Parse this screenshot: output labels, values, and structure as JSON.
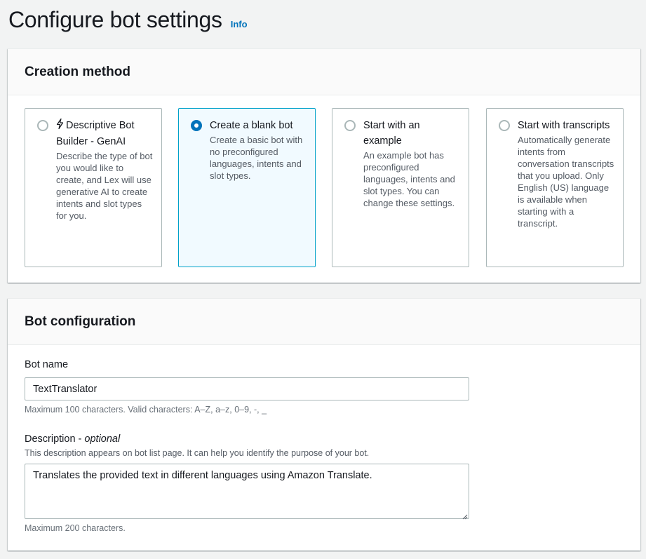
{
  "header": {
    "title": "Configure bot settings",
    "info_label": "Info"
  },
  "creation_method": {
    "title": "Creation method",
    "selected": "blank",
    "options": [
      {
        "id": "genai",
        "icon": "lightning-bolt-icon",
        "label": "Descriptive Bot Builder - GenAI",
        "description": "Describe the type of bot you would like to create, and Lex will use generative AI to create intents and slot types for you."
      },
      {
        "id": "blank",
        "label": "Create a blank bot",
        "description": "Create a basic bot with no preconfigured languages, intents and slot types."
      },
      {
        "id": "example",
        "label": "Start with an example",
        "description": "An example bot has preconfigured languages, intents and slot types. You can change these settings."
      },
      {
        "id": "transcripts",
        "label": "Start with transcripts",
        "description": "Automatically generate intents from conversation transcripts that you upload. Only English (US) language is available when starting with a transcript."
      }
    ]
  },
  "bot_configuration": {
    "title": "Bot configuration",
    "bot_name": {
      "label": "Bot name",
      "value": "TextTranslator",
      "hint": "Maximum 100 characters. Valid characters: A–Z, a–z, 0–9, -, _"
    },
    "description": {
      "label": "Description",
      "label_suffix": "optional",
      "label_separator": " - ",
      "help": "This description appears on bot list page. It can help you identify the purpose of your bot.",
      "value": "Translates the provided text in different languages using Amazon Translate.",
      "hint": "Maximum 200 characters."
    }
  },
  "colors": {
    "accent": "#0073bb",
    "selected_tile_bg": "#f1faff",
    "selected_tile_border": "#00a1c9",
    "page_bg": "#f2f3f3"
  }
}
